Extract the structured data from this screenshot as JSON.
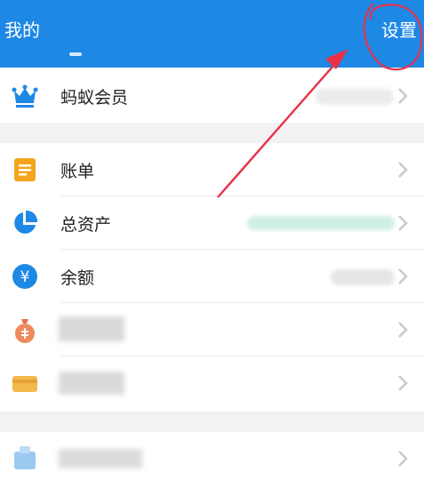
{
  "header": {
    "title": "我的",
    "settings_label": "设置"
  },
  "menu": {
    "member_label": "蚂蚁会员",
    "bill_label": "账单",
    "assets_label": "总资产",
    "balance_label": "余额",
    "yuan_symbol": "¥"
  },
  "colors": {
    "header_bg": "#1e88e5",
    "crown": "#1e88e5",
    "bill": "#f4a51c",
    "assets": "#1e88e5",
    "balance": "#1e88e5",
    "annotation": "#e8324a"
  },
  "icons": [
    "crown-icon",
    "bill-icon",
    "pie-chart-icon",
    "yuan-icon",
    "money-bag-icon",
    "card-icon",
    "bank-icon",
    "chevron-right-icon"
  ]
}
